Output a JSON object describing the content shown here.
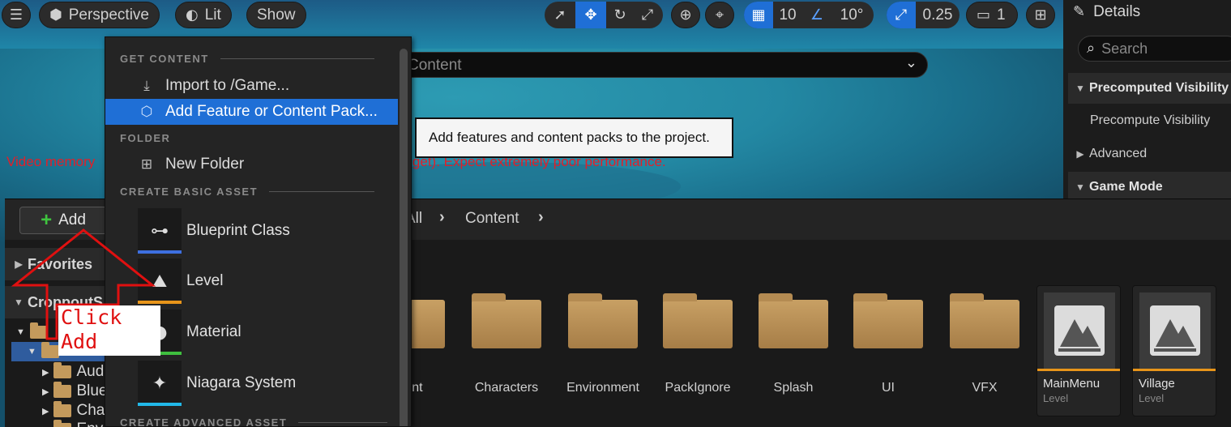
{
  "toolbar": {
    "perspective_label": "Perspective",
    "lit_label": "Lit",
    "show_label": "Show",
    "grid_snap_value": "10",
    "rotation_snap_value": "10°",
    "scale_snap_value": "0.25",
    "camera_speed_value": "1"
  },
  "viewport": {
    "warning_left": "Video memory",
    "warning_right": "udget). Expect extremely poor performance."
  },
  "details": {
    "title": "Details",
    "search_placeholder": "Search",
    "rows": [
      {
        "label": "Precomputed Visibility",
        "kind": "category",
        "expanded": true
      },
      {
        "label": "Precompute Visibility",
        "kind": "property"
      },
      {
        "label": "Advanced",
        "kind": "collapsed"
      },
      {
        "label": "Game Mode",
        "kind": "category",
        "expanded": true
      }
    ]
  },
  "content_browser": {
    "add_label": "Add",
    "breadcrumb": [
      "All",
      "Content"
    ],
    "path_placeholder": "Content",
    "sidebar": {
      "favorites": "Favorites",
      "project": "CroppoutS",
      "tree": [
        "Aud",
        "Blue",
        "Cha",
        "Env"
      ]
    },
    "folders": [
      "print",
      "Characters",
      "Environment",
      "PackIgnore",
      "Splash",
      "UI",
      "VFX"
    ],
    "levels": [
      {
        "name": "MainMenu",
        "type": "Level"
      },
      {
        "name": "Village",
        "type": "Level"
      }
    ]
  },
  "add_menu": {
    "sections": {
      "get_content": "GET CONTENT",
      "folder": "FOLDER",
      "basic": "CREATE BASIC ASSET",
      "advanced": "CREATE ADVANCED ASSET"
    },
    "items": {
      "import": "Import to /Game...",
      "add_feature": "Add Feature or Content Pack...",
      "new_folder": "New Folder"
    },
    "assets": [
      {
        "label": "Blueprint Class",
        "stripe": "#3d6fe0"
      },
      {
        "label": "Level",
        "stripe": "#e8951a"
      },
      {
        "label": "Material",
        "stripe": "#3fbf3f"
      },
      {
        "label": "Niagara System",
        "stripe": "#22b8e8"
      }
    ]
  },
  "tooltip": {
    "text": "Add features and content packs to the project."
  },
  "annotation": {
    "line1": "Click",
    "line2": "Add",
    "color": "#e01010"
  }
}
